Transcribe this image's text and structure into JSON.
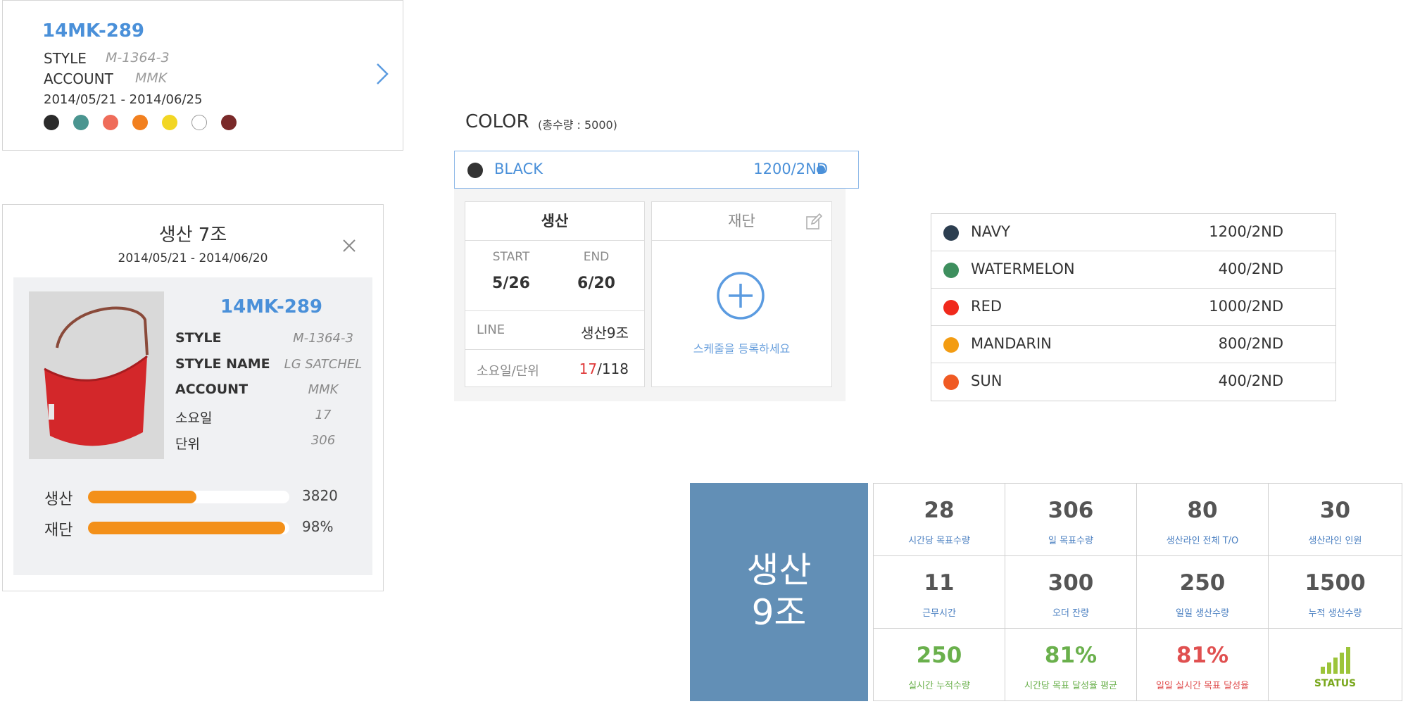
{
  "order_card": {
    "code": "14MK-289",
    "style_label": "STYLE",
    "style_value": "M-1364-3",
    "account_label": "ACCOUNT",
    "account_value": "MMK",
    "date_range": "2014/05/21 - 2014/06/25",
    "color_swatches": [
      "#2b2b2b",
      "#4a9590",
      "#ef6c5a",
      "#f2801f",
      "#f2d624",
      "#ffffff",
      "#7a2a2a"
    ]
  },
  "detail_card": {
    "title": "생산 7조",
    "date_range": "2014/05/21 - 2014/06/20",
    "code": "14MK-289",
    "fields": [
      {
        "label": "STYLE",
        "value": "M-1364-3"
      },
      {
        "label": "STYLE NAME",
        "value": "LG SATCHEL"
      },
      {
        "label": "ACCOUNT",
        "value": "MMK"
      },
      {
        "label": "소요일",
        "value": "17"
      },
      {
        "label": "단위",
        "value": "306"
      }
    ],
    "progress": [
      {
        "label": "생산",
        "fraction": 0.54,
        "value": "3820"
      },
      {
        "label": "재단",
        "fraction": 0.98,
        "value": "98%"
      }
    ]
  },
  "color_panel": {
    "title": "COLOR",
    "total": "(총수량 : 5000)",
    "selected": {
      "name": "BLACK",
      "qty": "1200/2ND",
      "color": "#333333"
    },
    "production": {
      "title": "생산",
      "start_label": "START",
      "start_value": "5/26",
      "end_label": "END",
      "end_value": "6/20",
      "line_label": "LINE",
      "line_value": "생산9조",
      "days_label": "소요일/단위",
      "days_value_red": "17",
      "days_value_rest": "/118"
    },
    "cutting": {
      "title": "재단",
      "message": "스케줄을 등록하세요"
    }
  },
  "color_list": [
    {
      "name": "NAVY",
      "qty": "1200/2ND",
      "color": "#2c3e50"
    },
    {
      "name": "WATERMELON",
      "qty": "400/2ND",
      "color": "#3e8f5e"
    },
    {
      "name": "RED",
      "qty": "1000/2ND",
      "color": "#f0291c"
    },
    {
      "name": "MANDARIN",
      "qty": "800/2ND",
      "color": "#f39c12"
    },
    {
      "name": "SUN",
      "qty": "400/2ND",
      "color": "#f05a23"
    }
  ],
  "dashboard": {
    "line_title_1": "생산",
    "line_title_2": "9조",
    "stats": [
      {
        "num": "28",
        "label": "시간당 목표수량",
        "tone": ""
      },
      {
        "num": "306",
        "label": "일 목표수량",
        "tone": ""
      },
      {
        "num": "80",
        "label": "생산라인 전체 T/O",
        "tone": ""
      },
      {
        "num": "30",
        "label": "생산라인 인원",
        "tone": ""
      },
      {
        "num": "11",
        "label": "근무시간",
        "tone": ""
      },
      {
        "num": "300",
        "label": "오더 잔량",
        "tone": ""
      },
      {
        "num": "250",
        "label": "일일 생산수량",
        "tone": ""
      },
      {
        "num": "1500",
        "label": "누적 생산수량",
        "tone": ""
      },
      {
        "num": "250",
        "label": "실시간 누적수량",
        "tone": "green"
      },
      {
        "num": "81%",
        "label": "시간당 목표 달성율 평균",
        "tone": "green"
      },
      {
        "num": "81%",
        "label": "일일 실시간 목표 달성율",
        "tone": "red"
      }
    ],
    "status_label": "STATUS"
  }
}
